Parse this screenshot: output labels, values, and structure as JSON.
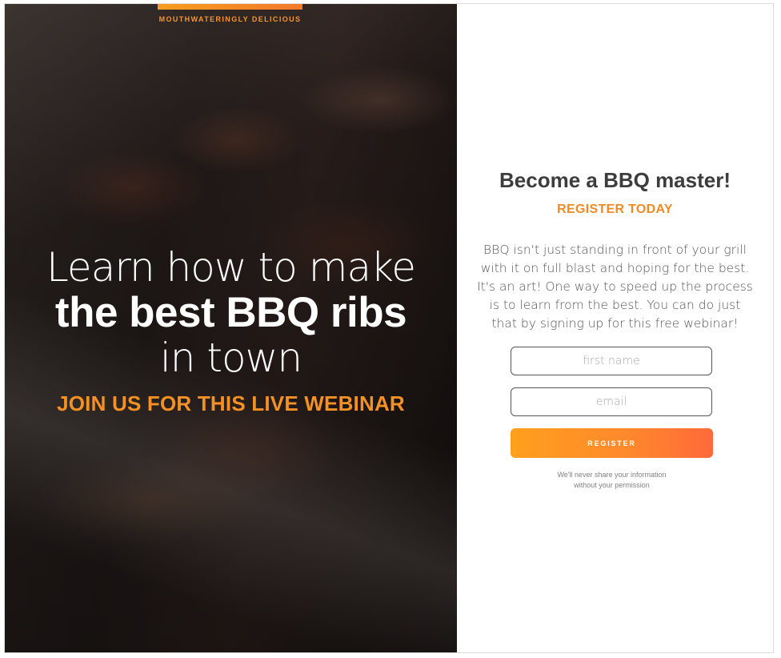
{
  "hero": {
    "tagline": "MOUTHWATERINGLY DELICIOUS",
    "headline_line1": "Learn how to make",
    "headline_line2": "the best BBQ ribs",
    "headline_line3": "in town",
    "subheadline": "JOIN US FOR THIS LIVE WEBINAR",
    "background_image": "bbq-ribs-photo"
  },
  "form_panel": {
    "title": "Become a BBQ master!",
    "subtitle": "REGISTER TODAY",
    "description": "BBQ isn't just standing in front of your grill with it on full blast and hoping for the best. It's an art! One way to speed up the process is to learn from the best. You can do just that by signing up for this free webinar!",
    "first_name_placeholder": "first name",
    "first_name_value": "",
    "email_placeholder": "email",
    "email_value": "",
    "register_label": "REGISTER",
    "privacy_line1": "We'll never share your information",
    "privacy_line2": "without your permission"
  },
  "colors": {
    "accent": "#f39533",
    "button_gradient_start": "#ffa01d",
    "button_gradient_end": "#ff6a3a",
    "title": "#3d3d3d",
    "body_text": "#555555"
  }
}
